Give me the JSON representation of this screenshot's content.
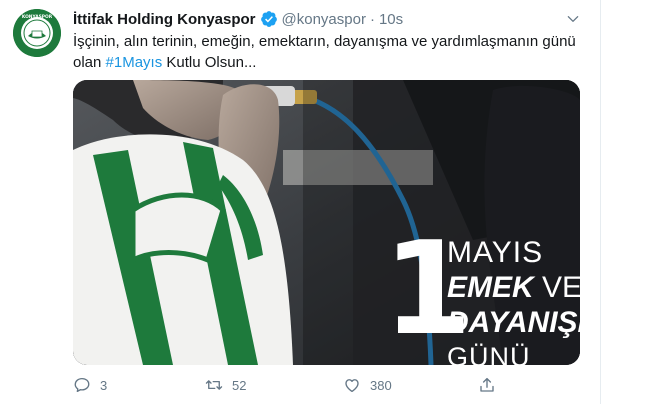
{
  "tweet": {
    "author": {
      "display_name": "İttifak Holding Konyaspor",
      "handle": "@konyaspor",
      "separator": "·",
      "time": "10s",
      "verified": true,
      "avatar_text": "KONYASPOR"
    },
    "text": {
      "line1": "İşçinin, alın terinin, emeğin, emektarın, dayanışma ve yardımlaşmanın günü",
      "line2_prefix": "olan ",
      "hashtag": "#1Mayıs",
      "line2_suffix": " Kutlu Olsun..."
    },
    "media": {
      "big_number": "1",
      "line1": "MAYIS",
      "line2_bold": "EMEK",
      "line2_rest": " VE",
      "line3": "DAYANIŞMA",
      "line4": "GÜNÜ"
    },
    "actions": {
      "replies": "3",
      "retweets": "52",
      "likes": "380"
    }
  },
  "colors": {
    "link": "#1b95e0",
    "secondary_text": "#657786",
    "verified": "#1da1f2",
    "club_green": "#1e7a3c"
  },
  "icons": [
    "verified-badge-icon",
    "chevron-down-icon",
    "reply-icon",
    "retweet-icon",
    "like-icon",
    "share-icon"
  ]
}
